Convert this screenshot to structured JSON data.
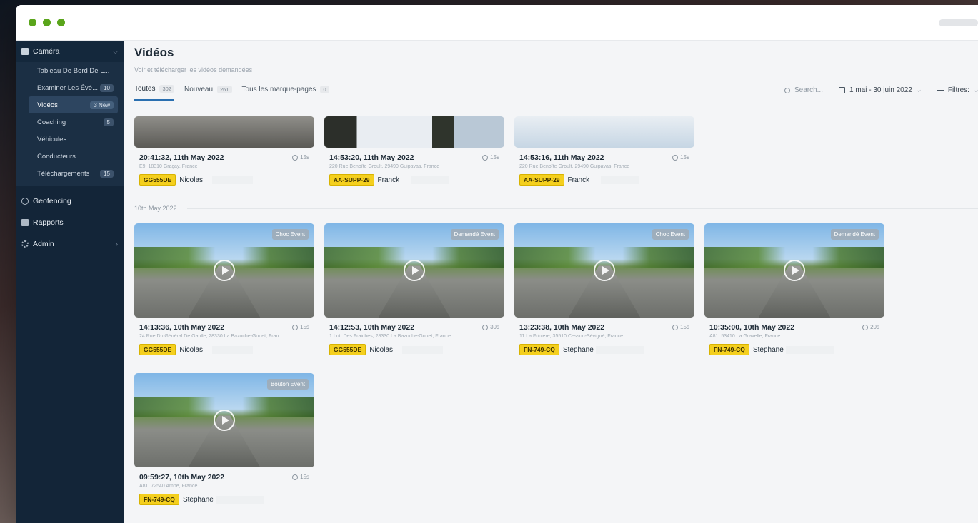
{
  "sidebar": {
    "camera_label": "Caméra",
    "items": [
      {
        "label": "Tableau De Bord De L...",
        "badge": ""
      },
      {
        "label": "Examiner Les Évé...",
        "badge": "10"
      },
      {
        "label": "Vidéos",
        "badge": "3 New"
      },
      {
        "label": "Coaching",
        "badge": "5"
      },
      {
        "label": "Véhicules",
        "badge": ""
      },
      {
        "label": "Conducteurs",
        "badge": ""
      },
      {
        "label": "Téléchargements",
        "badge": "15"
      }
    ],
    "geofencing_label": "Geofencing",
    "rapports_label": "Rapports",
    "admin_label": "Admin"
  },
  "header": {
    "title": "Vidéos",
    "subtitle": "Voir et télécharger les vidéos demandées"
  },
  "tabs": [
    {
      "label": "Toutes",
      "count": "302"
    },
    {
      "label": "Nouveau",
      "count": "261"
    },
    {
      "label": "Tous les marque-pages",
      "count": "0"
    }
  ],
  "toolbar": {
    "search_placeholder": "Search...",
    "date_range": "1 mai - 30 juin 2022",
    "filters_label": "Filtres:"
  },
  "date_separator": "10th May 2022",
  "videos": [
    {
      "time": "20:41:32, 11th May 2022",
      "duration": "15s",
      "address": "E9, 18310 Graçay, France",
      "plate": "GG555DE",
      "driver": "Nicolas",
      "event": ""
    },
    {
      "time": "14:53:20, 11th May 2022",
      "duration": "15s",
      "address": "220 Rue Benoîte Groult, 29490 Guipavas, France",
      "plate": "AA-SUPP-29",
      "driver": "Franck",
      "event": ""
    },
    {
      "time": "14:53:16, 11th May 2022",
      "duration": "15s",
      "address": "220 Rue Benoîte Groult, 29490 Guipavas, France",
      "plate": "AA-SUPP-29",
      "driver": "Franck",
      "event": ""
    },
    {
      "time": "14:13:36, 10th May 2022",
      "duration": "15s",
      "address": "24 Rue Du Général De Gaulle, 28330 La Bazoche-Gouet, Fran...",
      "plate": "GG555DE",
      "driver": "Nicolas",
      "event": "Choc Event"
    },
    {
      "time": "14:12:53, 10th May 2022",
      "duration": "30s",
      "address": "1 Lot. Des Fraiches, 28330 La Bazoche-Gouet, France",
      "plate": "GG555DE",
      "driver": "Nicolas",
      "event": "Demandé Event"
    },
    {
      "time": "13:23:38, 10th May 2022",
      "duration": "15s",
      "address": "11 La Frinière, 35510 Cesson-Sévigné, France",
      "plate": "FN-749-CQ",
      "driver": "Stephane",
      "event": "Choc Event"
    },
    {
      "time": "10:35:00, 10th May 2022",
      "duration": "20s",
      "address": "A81, 53410 La Gravelle, France",
      "plate": "FN-749-CQ",
      "driver": "Stephane",
      "event": "Demandé Event"
    },
    {
      "time": "09:59:27, 10th May 2022",
      "duration": "15s",
      "address": "A81, 72540 Amné, France",
      "plate": "FN-749-CQ",
      "driver": "Stephane",
      "event": "Bouton Event"
    }
  ]
}
